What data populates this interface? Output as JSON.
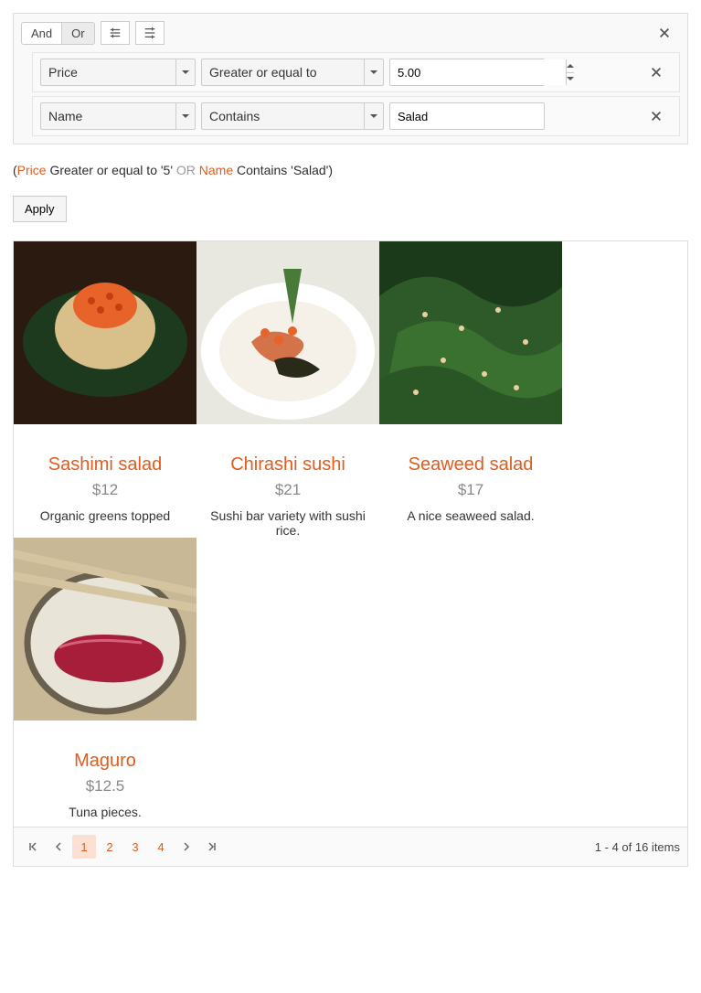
{
  "filter": {
    "and_label": "And",
    "or_label": "Or",
    "active_logic": "or",
    "rules": [
      {
        "field": "Price",
        "op": "Greater or equal to",
        "value": "5.00",
        "type": "number"
      },
      {
        "field": "Name",
        "op": "Contains",
        "value": "Salad",
        "type": "text"
      }
    ]
  },
  "expression": {
    "open": "(",
    "p1_field": "Price",
    "p1_rest": " Greater or equal to '5' ",
    "logic": "OR",
    "spacer": " ",
    "p2_field": "Name",
    "p2_rest": " Contains 'Salad')",
    "close": ""
  },
  "apply_label": "Apply",
  "items": [
    {
      "title": "Sashimi salad",
      "price": "$12",
      "desc": "Organic greens topped"
    },
    {
      "title": "Chirashi sushi",
      "price": "$21",
      "desc": "Sushi bar variety with sushi rice."
    },
    {
      "title": "Seaweed salad",
      "price": "$17",
      "desc": "A nice seaweed salad."
    },
    {
      "title": "Maguro",
      "price": "$12.5",
      "desc": "Tuna pieces."
    }
  ],
  "pager": {
    "pages": [
      "1",
      "2",
      "3",
      "4"
    ],
    "current": "1",
    "info": "1 - 4 of 16 items"
  }
}
